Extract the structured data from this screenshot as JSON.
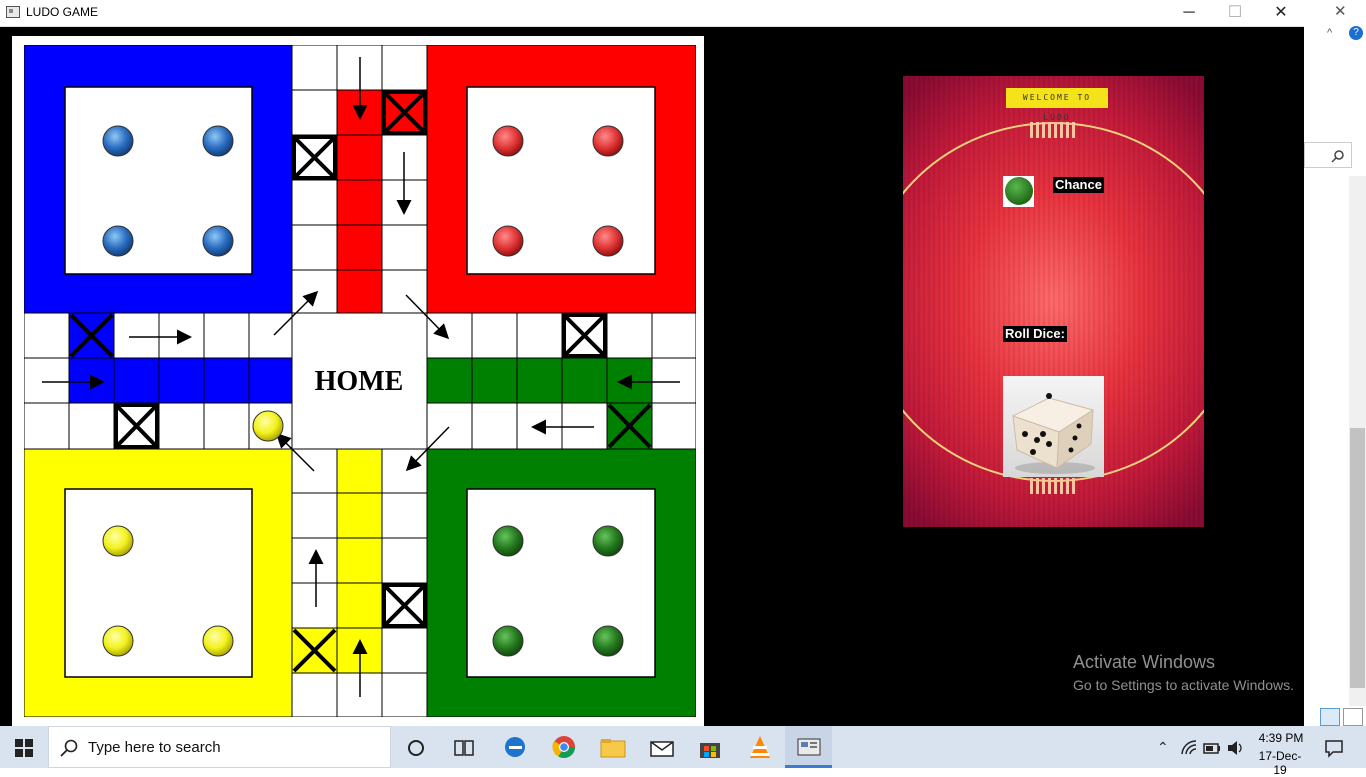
{
  "window": {
    "title": "LUDO GAME",
    "minimize_glyph": "─",
    "maximize_glyph": "☐",
    "close_glyph": "✕"
  },
  "board": {
    "home_label": "HOME",
    "colors": {
      "blue": "#0000ff",
      "red": "#ff0000",
      "yellow": "#ffff00",
      "green": "#008000"
    }
  },
  "panel": {
    "welcome_text": "WELCOME TO LUDO",
    "chance_label": "Chance",
    "roll_dice_label": "Roll Dice:",
    "current_turn_color": "green",
    "dice_value": 5
  },
  "watermark": {
    "line1": "Activate Windows",
    "line2": "Go to Settings to activate Windows."
  },
  "taskbar": {
    "search_placeholder": "Type here to search",
    "time": "4:39 PM",
    "date": "17-Dec-19",
    "icons": [
      "windows-start-icon",
      "search-icon",
      "cortana-icon",
      "task-view-icon",
      "edge-icon",
      "chrome-icon",
      "file-explorer-icon",
      "mail-icon",
      "store-icon",
      "vlc-icon",
      "ludo-app-icon"
    ]
  }
}
